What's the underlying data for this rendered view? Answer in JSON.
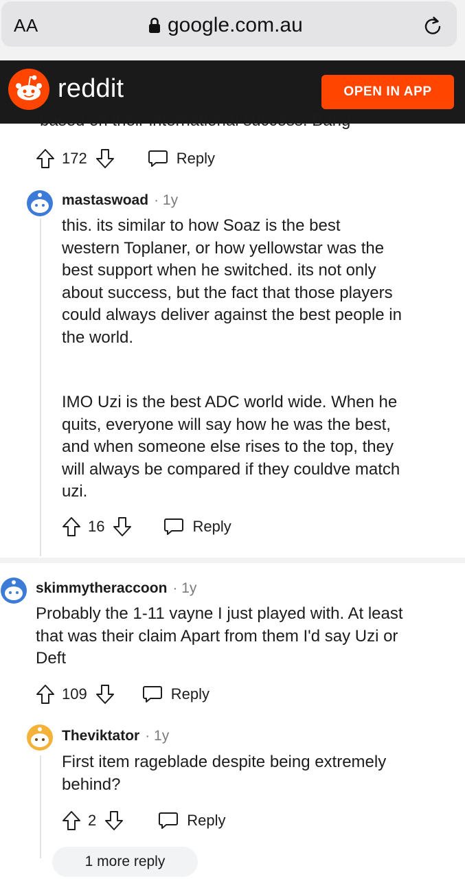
{
  "browser": {
    "aa_label": "AA",
    "domain": "google.com.au"
  },
  "reddit_header": {
    "wordmark": "reddit",
    "open_in_app": "OPEN IN APP",
    "brand_color": "#ff4500"
  },
  "partial_comment": {
    "cut_text": "based on their international success. Bang",
    "votes": "172",
    "reply": "Reply"
  },
  "comments": [
    {
      "username": "mastaswoad",
      "age": "· 1y",
      "paragraphs": [
        [
          "this. its similar to how Soaz is the best",
          "western Toplaner, or how yellowstar was the",
          "best support when he switched. its not only",
          "about success, but the fact that those players",
          "could always deliver against the best people in",
          "the world."
        ],
        [
          "IMO Uzi is the best ADC world wide. When he",
          "quits, everyone will say how he was the best,",
          "and when someone else rises to the top, they",
          "will always be compared if they couldve match",
          "uzi."
        ]
      ],
      "votes": "16",
      "reply": "Reply"
    },
    {
      "username": "skimmytheraccoon",
      "age": "· 1y",
      "lines": [
        "Probably the 1-11 vayne I just played with. At least",
        "that was their claim Apart from them I'd say Uzi or",
        "Deft"
      ],
      "votes": "109",
      "reply": "Reply"
    },
    {
      "username": "Theviktator",
      "age": "· 1y",
      "lines": [
        "First item rageblade despite being extremely",
        "behind?"
      ],
      "votes": "2",
      "reply": "Reply"
    }
  ],
  "more_replies": "1 more reply"
}
